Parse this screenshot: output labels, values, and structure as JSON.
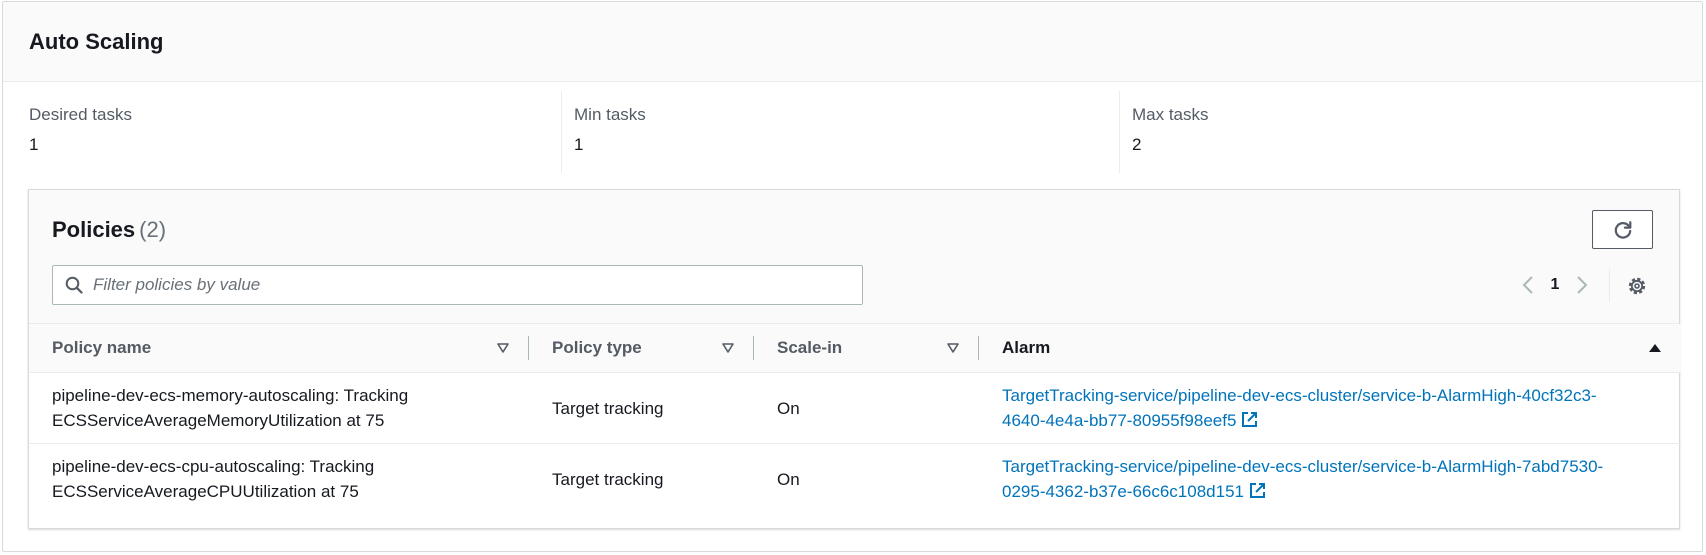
{
  "section": {
    "title": "Auto Scaling"
  },
  "metrics": [
    {
      "label": "Desired tasks",
      "value": "1"
    },
    {
      "label": "Min tasks",
      "value": "1"
    },
    {
      "label": "Max tasks",
      "value": "2"
    }
  ],
  "policies": {
    "title": "Policies",
    "count": "(2)",
    "refresh_icon": "refresh-icon",
    "filter_placeholder": "Filter policies by value",
    "filter_value": "",
    "pagination": {
      "current_page": "1"
    },
    "columns": [
      "Policy name",
      "Policy type",
      "Scale-in",
      "Alarm"
    ],
    "rows": [
      {
        "name_line1": "pipeline-dev-ecs-memory-autoscaling: Tracking",
        "name_line2": "ECSServiceAverageMemoryUtilization at 75",
        "type": "Target tracking",
        "scale_in": "On",
        "alarm_line1": "TargetTracking-service/pipeline-dev-ecs-cluster/service-b-AlarmHigh-40cf32c3-",
        "alarm_line2": "4640-4e4a-bb77-80955f98eef5"
      },
      {
        "name_line1": "pipeline-dev-ecs-cpu-autoscaling: Tracking",
        "name_line2": "ECSServiceAverageCPUUtilization at 75",
        "type": "Target tracking",
        "scale_in": "On",
        "alarm_line1": "TargetTracking-service/pipeline-dev-ecs-cluster/service-b-AlarmHigh-7abd7530-",
        "alarm_line2": "0295-4362-b37e-66c6c108d151"
      }
    ]
  },
  "colors": {
    "link": "#0073bb",
    "text": "#16191f",
    "muted": "#545b64",
    "border": "#d5dbdb"
  }
}
